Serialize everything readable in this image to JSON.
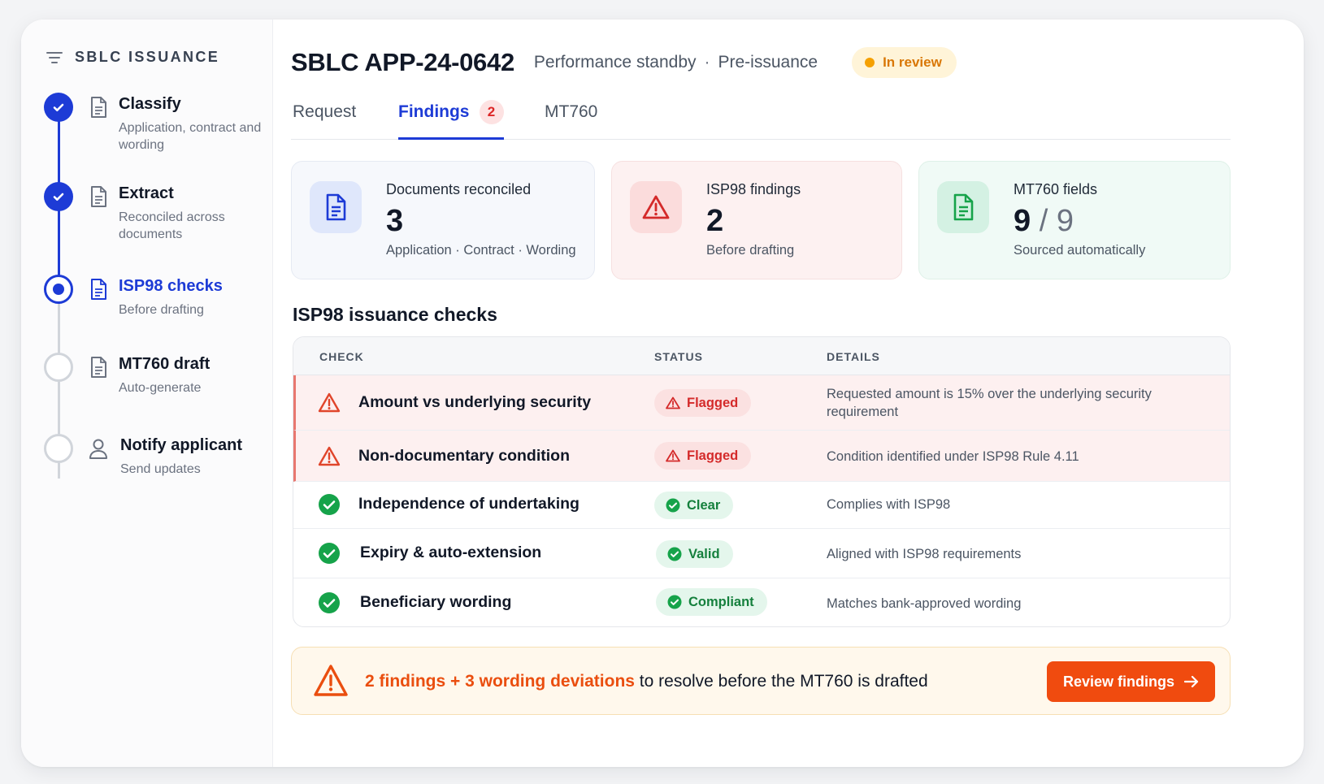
{
  "sidebar": {
    "title": "SBLC ISSUANCE",
    "steps": [
      {
        "title": "Classify",
        "subtitle": "Application, contract and wording",
        "state": "done"
      },
      {
        "title": "Extract",
        "subtitle": "Reconciled across documents",
        "state": "done"
      },
      {
        "title": "ISP98 checks",
        "subtitle": "Before drafting",
        "state": "current"
      },
      {
        "title": "MT760 draft",
        "subtitle": "Auto-generate",
        "state": "todo"
      },
      {
        "title": "Notify applicant",
        "subtitle": "Send updates",
        "state": "todo"
      }
    ]
  },
  "header": {
    "title": "SBLC APP-24-0642",
    "type": "Performance standby",
    "separator": "·",
    "stage": "Pre-issuance",
    "status": "In review"
  },
  "tabs": [
    {
      "label": "Request"
    },
    {
      "label": "Findings",
      "count": "2",
      "active": true
    },
    {
      "label": "MT760"
    }
  ],
  "stats": {
    "documents": {
      "label": "Documents reconciled",
      "value": "3",
      "sub": "Application · Contract · Wording"
    },
    "findings": {
      "label": "ISP98 findings",
      "value": "2",
      "sub": "Before drafting"
    },
    "fields": {
      "label": "MT760 fields",
      "value": "9",
      "total": "/ 9",
      "sub": "Sourced automatically"
    }
  },
  "checks": {
    "title": "ISP98 issuance checks",
    "columns": [
      "CHECK",
      "STATUS",
      "DETAILS"
    ],
    "rows": [
      {
        "check": "Amount vs underlying security",
        "status": "Flagged",
        "details": "Requested amount is 15% over the underlying security requirement"
      },
      {
        "check": "Non-documentary condition",
        "status": "Flagged",
        "details": "Condition identified under ISP98 Rule 4.11"
      },
      {
        "check": "Independence of undertaking",
        "status": "Clear",
        "details": "Complies with ISP98"
      },
      {
        "check": "Expiry & auto-extension",
        "status": "Valid",
        "details": "Aligned with ISP98 requirements"
      },
      {
        "check": "Beneficiary wording",
        "status": "Compliant",
        "details": "Matches bank-approved wording"
      }
    ]
  },
  "banner": {
    "highlight": "2 findings + 3 wording deviations",
    "text": " to resolve before the MT760 is drafted",
    "button": "Review findings"
  },
  "colors": {
    "accent": "#1d3bd6",
    "danger": "#d42a2a",
    "success": "#15803d",
    "warning": "#f5a000",
    "cta": "#f04b0f"
  }
}
